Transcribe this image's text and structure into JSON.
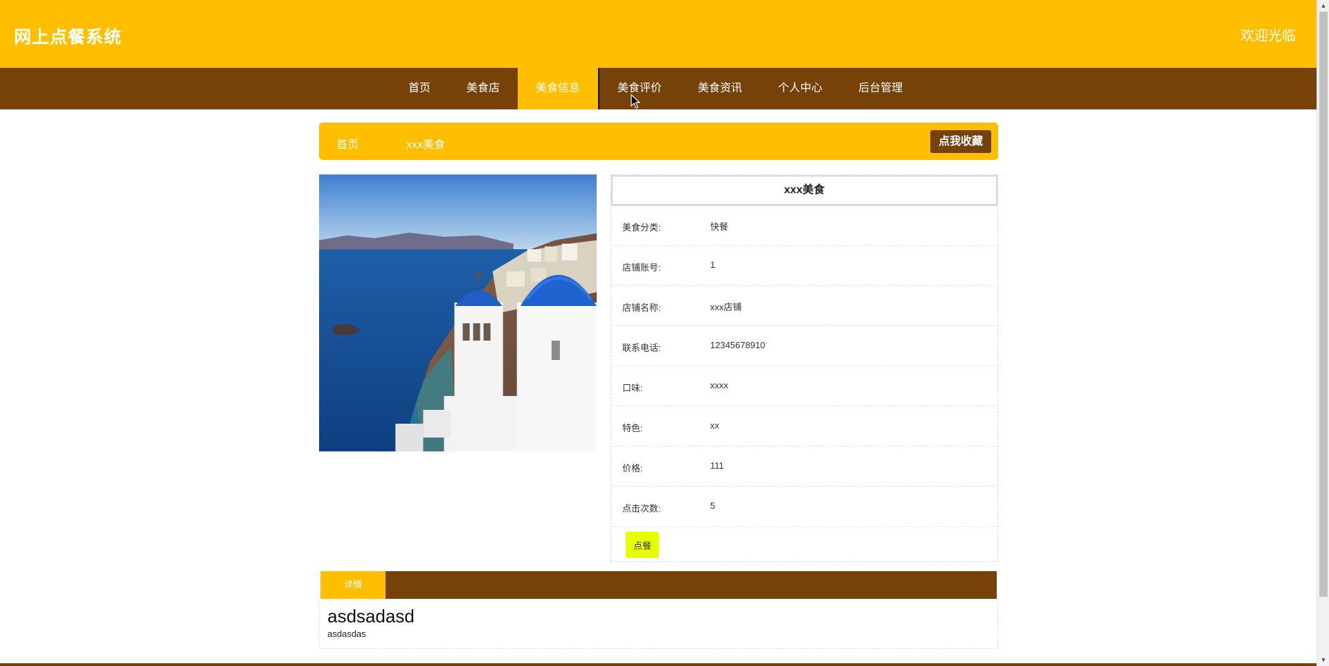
{
  "header": {
    "site_title": "网上点餐系统",
    "welcome": "欢迎光临"
  },
  "nav": {
    "items": [
      {
        "label": "首页"
      },
      {
        "label": "美食店"
      },
      {
        "label": "美食信息"
      },
      {
        "label": "美食评价"
      },
      {
        "label": "美食资讯"
      },
      {
        "label": "个人中心"
      },
      {
        "label": "后台管理"
      }
    ],
    "active_index": 2
  },
  "breadcrumb": {
    "home": "首页",
    "separator": "/",
    "current": "xxx美食",
    "favorite_button": "点我收藏"
  },
  "product": {
    "image_icon": "landscape-photo-icon",
    "title": "xxx美食",
    "fields": [
      {
        "label": "美食分类:",
        "value": "快餐"
      },
      {
        "label": "店铺账号:",
        "value": "1"
      },
      {
        "label": "店铺名称:",
        "value": "xxx店铺"
      },
      {
        "label": "联系电话:",
        "value": "12345678910"
      },
      {
        "label": "口味:",
        "value": "xxxx"
      },
      {
        "label": "特色:",
        "value": "xx"
      },
      {
        "label": "价格:",
        "value": "111"
      },
      {
        "label": "点击次数:",
        "value": "5"
      }
    ],
    "order_button": "点餐"
  },
  "detail": {
    "tab_label": "详情",
    "heading": "asdsadasd",
    "body": "asdasdas"
  },
  "colors": {
    "primary_yellow": "#FFBF00",
    "dark_brown": "#76420A",
    "order_button": "#E5FF00"
  }
}
